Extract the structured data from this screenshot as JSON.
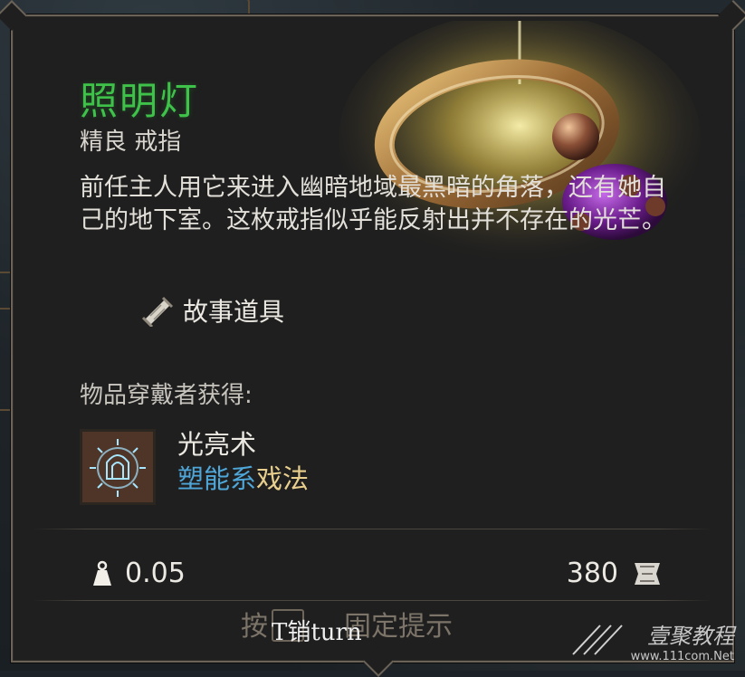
{
  "item": {
    "name": "照明灯",
    "rarity_type": "精良 戒指",
    "description": "前任主人用它来进入幽暗地域最黑暗的角落，还有她自己的地下室。这枚戒指似乎能反射出并不存在的光芒。",
    "tag": {
      "icon": "scroll-icon",
      "label": "故事道具"
    }
  },
  "wearer_gains": {
    "heading": "物品穿戴者获得:",
    "spell": {
      "icon": "light-spell-icon",
      "name": "光亮术",
      "school": "塑能系",
      "type": "戏法"
    }
  },
  "stats": {
    "weight": {
      "icon": "weight-icon",
      "value": "0.05"
    },
    "price": {
      "icon": "gold-coin-icon",
      "value": "380"
    }
  },
  "hint": {
    "prefix": "按",
    "suffix": "固定提示",
    "overlay": "T销turn"
  },
  "watermark": {
    "main": "壹聚教程",
    "sub": "www.111com.Net"
  },
  "colors": {
    "name": "#3fc24a",
    "school": "#4fa6d8",
    "spell_type": "#e9cf8d",
    "panel": "#1f1f1f",
    "border": "#6b6357"
  }
}
